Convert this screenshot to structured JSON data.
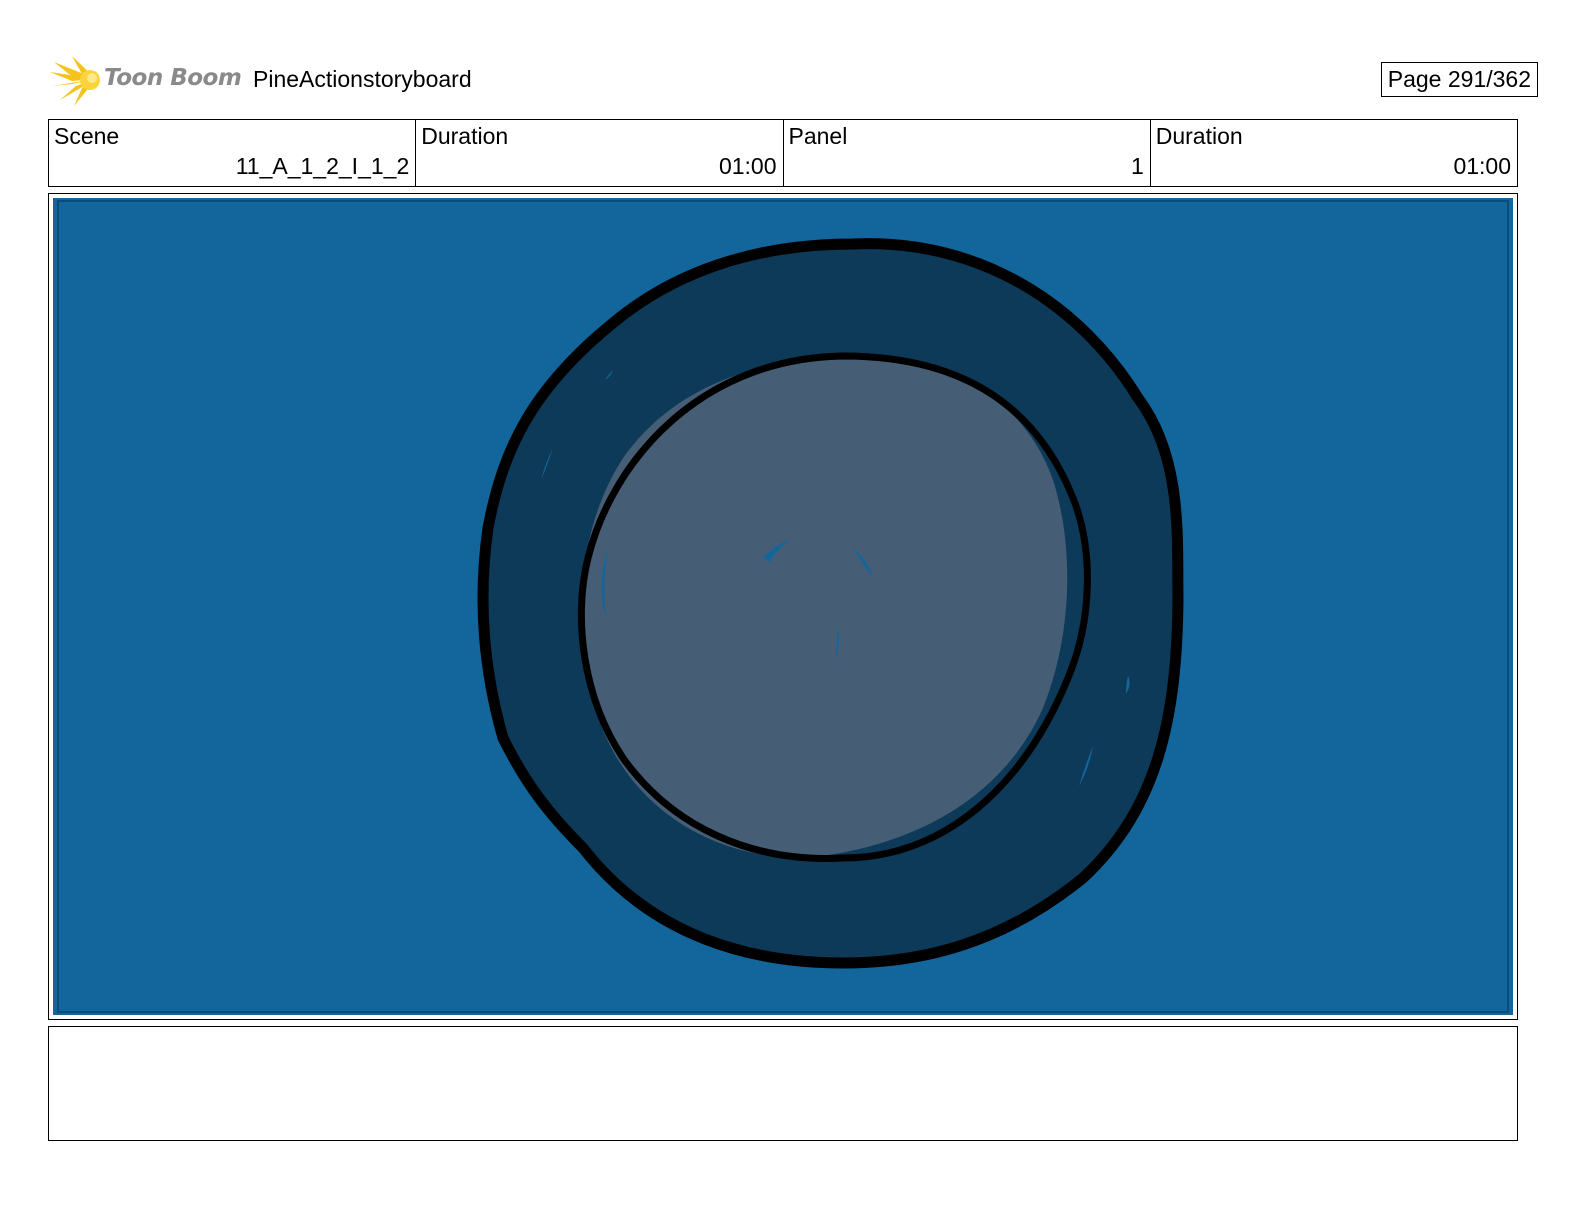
{
  "header": {
    "logo_text": "Toon Boom",
    "project_title": "PineActionstoryboard",
    "page_label": "Page 291/362"
  },
  "info": {
    "scene_label": "Scene",
    "scene_value": "11_A_1_2_I_1_2",
    "scene_duration_label": "Duration",
    "scene_duration_value": "01:00",
    "panel_label": "Panel",
    "panel_value": "1",
    "panel_duration_label": "Duration",
    "panel_duration_value": "01:00"
  },
  "notes": {
    "text": ""
  },
  "colors": {
    "panel_background": "#13669c",
    "ring_dark": "#0c3a58",
    "ring_inner": "#465e75",
    "outline": "#000000",
    "logo_star": "#f6c21c"
  }
}
